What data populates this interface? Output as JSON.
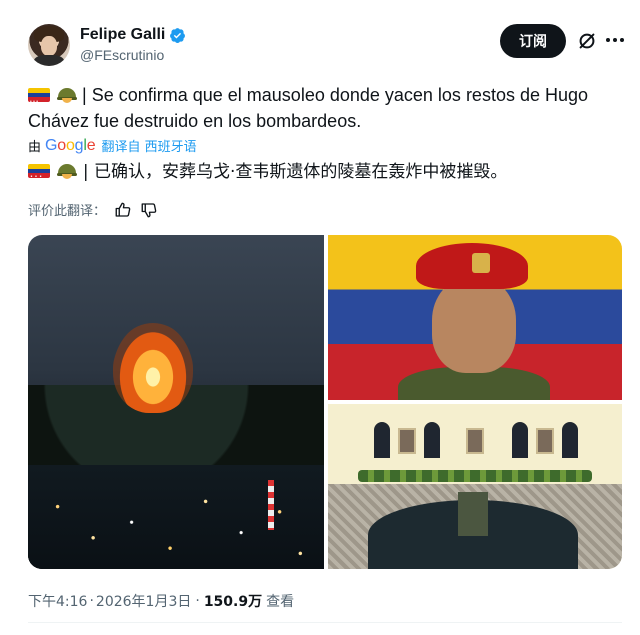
{
  "author": {
    "display_name": "Felipe Galli",
    "handle": "@FEscrutinio",
    "verified": true
  },
  "actions": {
    "subscribe_label": "订阅"
  },
  "tweet": {
    "text": "| Se confirma que el mausoleo donde yacen los restos de Hugo Chávez fue destruido en los bombardeos.",
    "emoji": [
      "venezuela-flag",
      "military-helmet"
    ]
  },
  "translation": {
    "by_label": "由",
    "provider": "Google",
    "from_label": "翻译自 西班牙语",
    "text": "| 已确认，安葬乌戈·查韦斯遗体的陵墓在轰炸中被摧毁。",
    "rate_label": "评价此翻译："
  },
  "meta": {
    "time": "下午4:16",
    "date": "2026年1月3日",
    "separator": "·",
    "views": "150.9万",
    "views_label": "查看"
  },
  "colors": {
    "accent": "#1d9bf0",
    "text": "#0f1419",
    "secondary": "#536471",
    "button_bg": "#0f1419"
  }
}
